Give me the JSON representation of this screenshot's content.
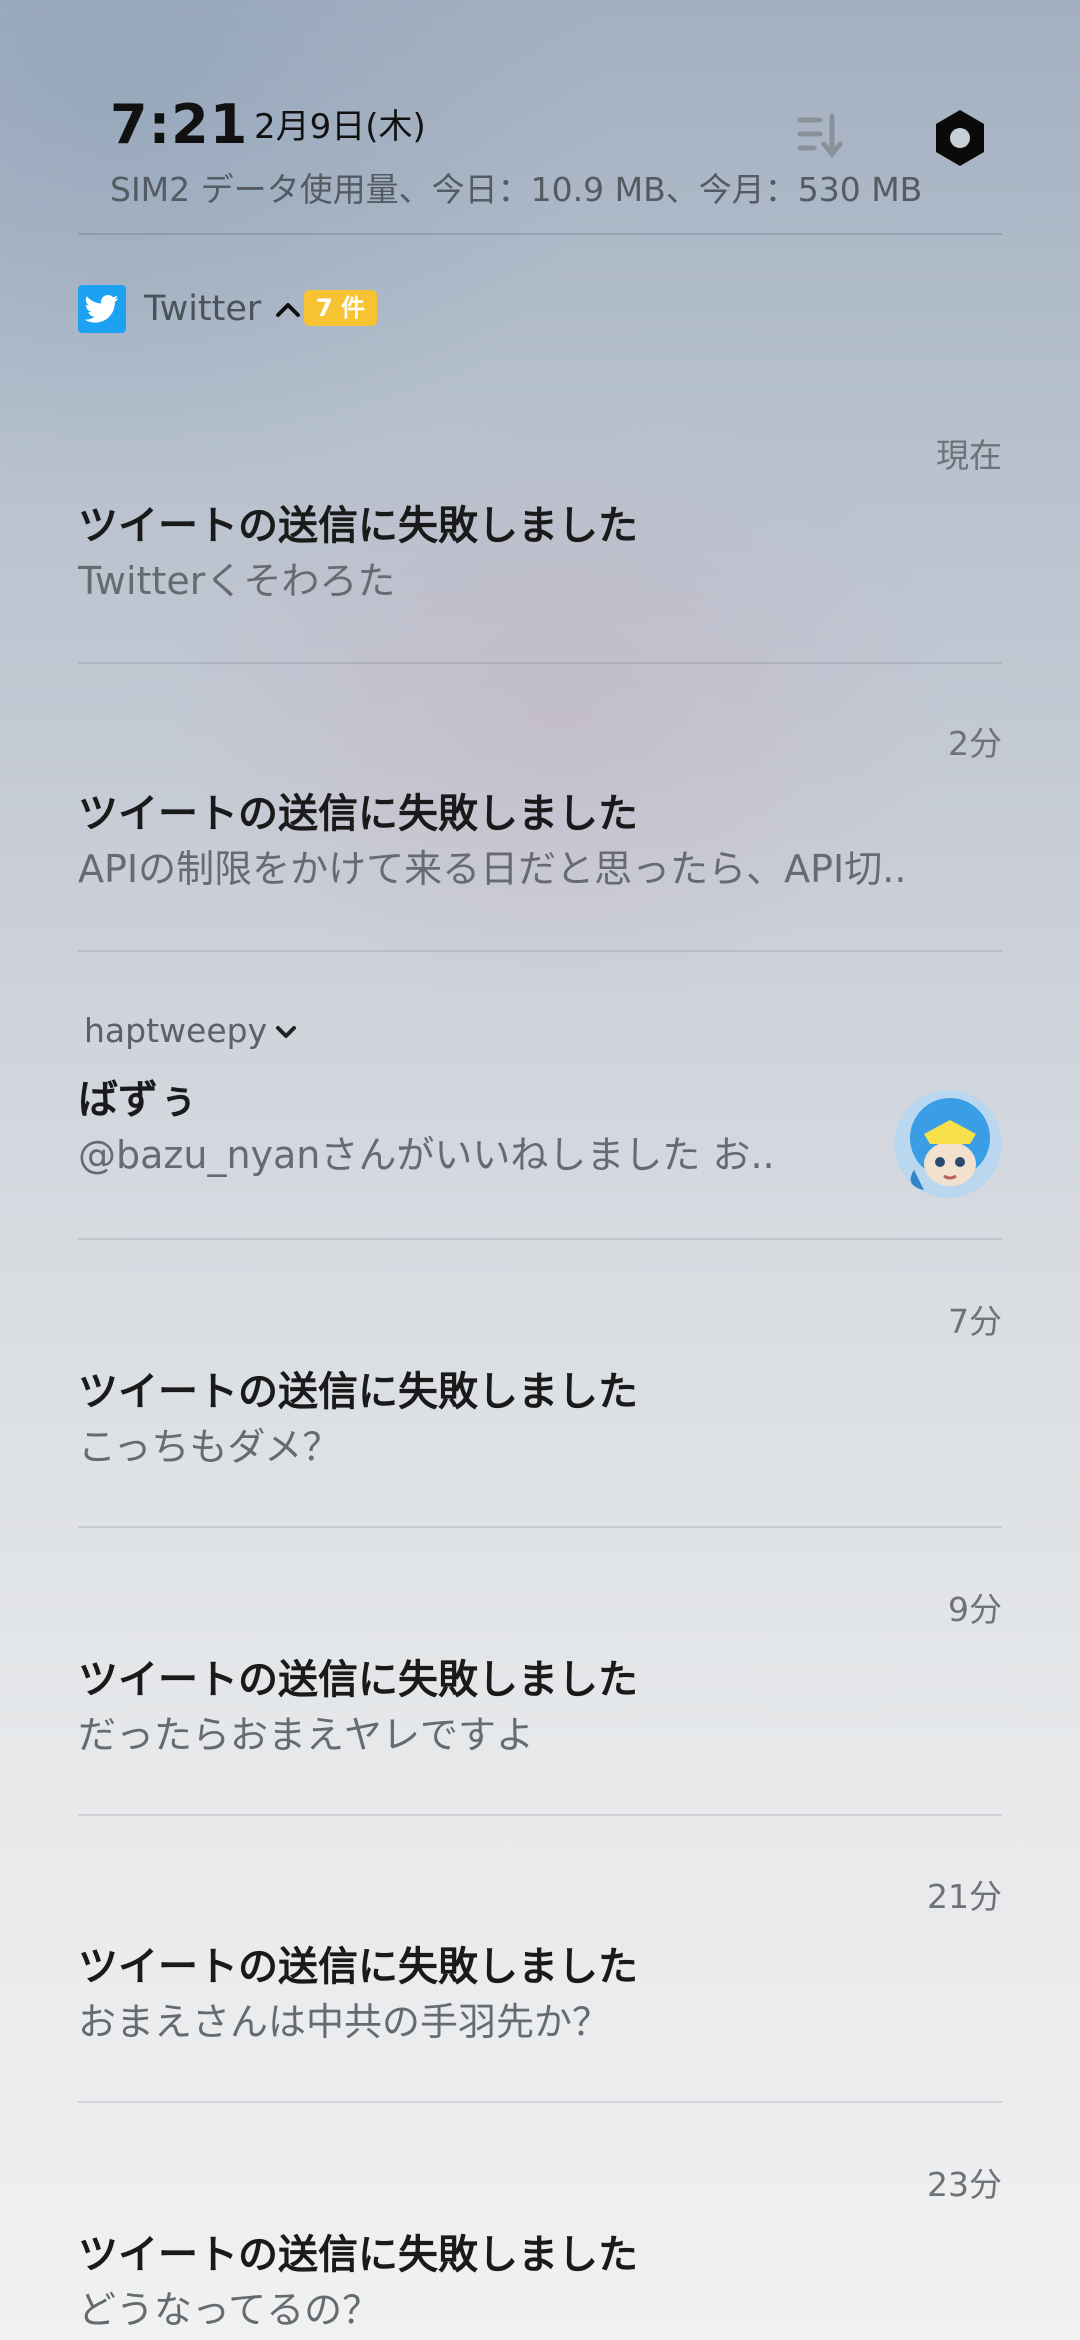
{
  "status": {
    "time": "7:21",
    "date": "2月9日(木)",
    "data_usage": "SIM2 データ使用量、今日：10.9 MB、今月：530 MB",
    "sort_icon": "sort-icon",
    "settings_icon": "settings-hexagon-icon"
  },
  "app": {
    "name": "Twitter",
    "count_badge": "7 件",
    "icon": "twitter-bird-icon",
    "brand_color": "#1da1f2",
    "badge_color": "#f7c332"
  },
  "notifications": [
    {
      "time": "現在",
      "title": "ツイートの送信に失敗しました",
      "body": "Twitterくそわろた"
    },
    {
      "time": "2分",
      "title": "ツイートの送信に失敗しました",
      "body": "APIの制限をかけて来る日だと思ったら、API切.."
    },
    {
      "account": "haptweepy",
      "title": "ばずぅ",
      "body": "@bazu_nyanさんがいいねしました お..",
      "avatar_icon": "avatar-penguin-character"
    },
    {
      "time": "7分",
      "title": "ツイートの送信に失敗しました",
      "body": "こっちもダメ？"
    },
    {
      "time": "9分",
      "title": "ツイートの送信に失敗しました",
      "body": "だったらおまえヤレですよ"
    },
    {
      "time": "21分",
      "title": "ツイートの送信に失敗しました",
      "body": "おまえさんは中共の手羽先か？"
    },
    {
      "time": "23分",
      "title": "ツイートの送信に失敗しました",
      "body": "どうなってるの？"
    }
  ]
}
